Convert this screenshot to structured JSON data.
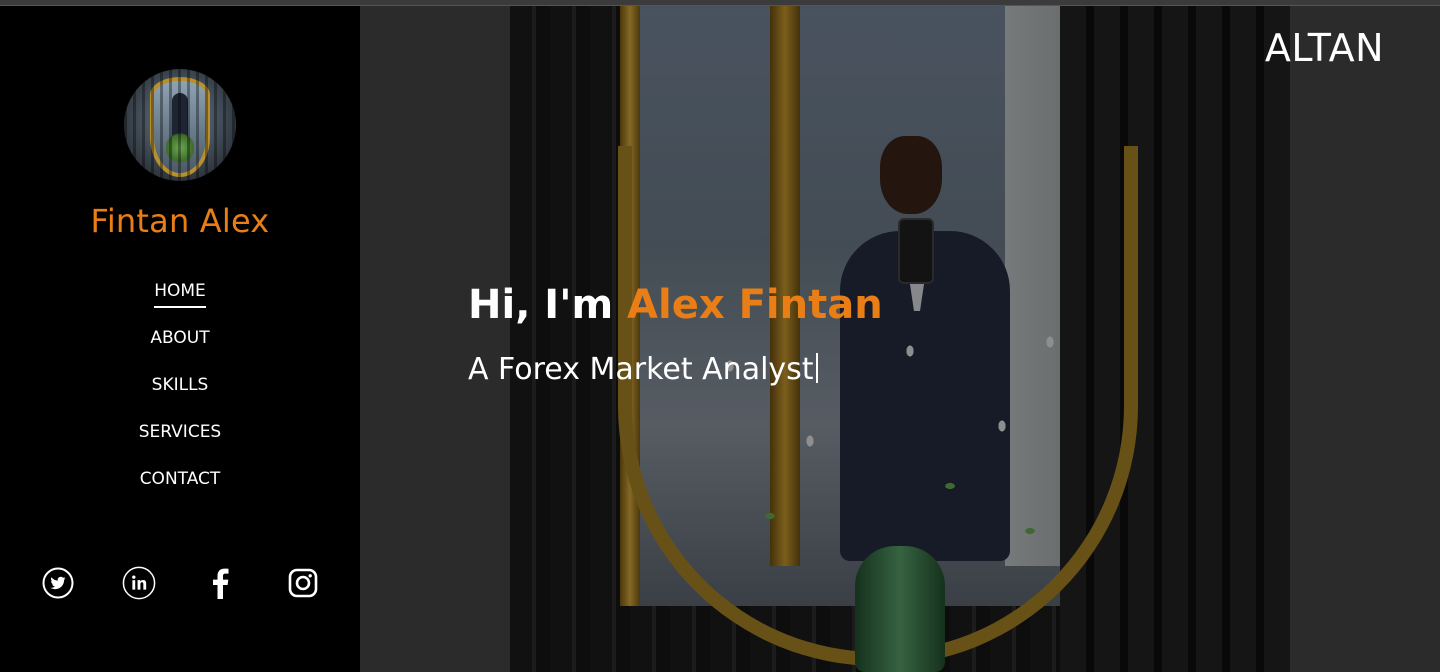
{
  "sidebar": {
    "profile_name": "Fintan Alex",
    "avatar_alt": "profile photo",
    "nav": [
      {
        "label": "HOME",
        "active": true
      },
      {
        "label": "ABOUT",
        "active": false
      },
      {
        "label": "SKILLS",
        "active": false
      },
      {
        "label": "SERVICES",
        "active": false
      },
      {
        "label": "CONTACT",
        "active": false
      }
    ],
    "social_icons": [
      "twitter-icon",
      "linkedin-icon",
      "facebook-icon",
      "instagram-icon"
    ]
  },
  "hero": {
    "brand": "ALTAN",
    "greeting_prefix": "Hi, I'm ",
    "greeting_name": "Alex Fintan",
    "tagline": "A Forex Market Analyst"
  },
  "colors": {
    "accent": "#e87e15",
    "sidebar_bg": "#000000",
    "hero_bg": "#2b2b2b",
    "text": "#ffffff"
  }
}
